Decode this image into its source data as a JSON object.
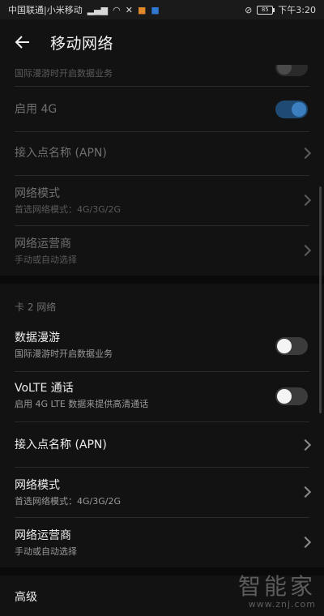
{
  "status_bar": {
    "carrier": "中国联通|小米移动",
    "icons_left": [
      "signal-icon",
      "wifi-icon",
      "wechat-icon",
      "app-icon-orange",
      "app-icon-blue"
    ],
    "icons_right": [
      "mute-icon",
      "battery-icon"
    ],
    "battery_level": "85",
    "time": "下午3:20"
  },
  "header": {
    "title": "移动网络",
    "back_icon": "arrow-left-icon"
  },
  "sim1": {
    "partial_roaming_sub": "国际漫游时开启数据业务",
    "enable4g_label": "启用 4G",
    "enable4g_on": true,
    "apn_label": "接入点名称 (APN)",
    "network_mode_label": "网络模式",
    "network_mode_value": "首选网络模式：4G/3G/2G",
    "operator_label": "网络运营商",
    "operator_value": "手动或自动选择"
  },
  "sim2": {
    "section_label": "卡 2 网络",
    "data_roaming_label": "数据漫游",
    "data_roaming_sub": "国际漫游时开启数据业务",
    "data_roaming_on": false,
    "volte_label": "VoLTE 通话",
    "volte_sub": "启用 4G LTE 数据来提供高清通话",
    "volte_on": false,
    "apn_label": "接入点名称 (APN)",
    "network_mode_label": "网络模式",
    "network_mode_value": "首选网络模式：4G/3G/2G",
    "operator_label": "网络运营商",
    "operator_value": "手动或自动选择"
  },
  "advanced": {
    "section_label": "高级"
  },
  "watermark": {
    "main": "智能家",
    "sub": "www.znj.com"
  },
  "colors": {
    "background": "#121212",
    "accent_toggle": "#3c7fc0"
  }
}
